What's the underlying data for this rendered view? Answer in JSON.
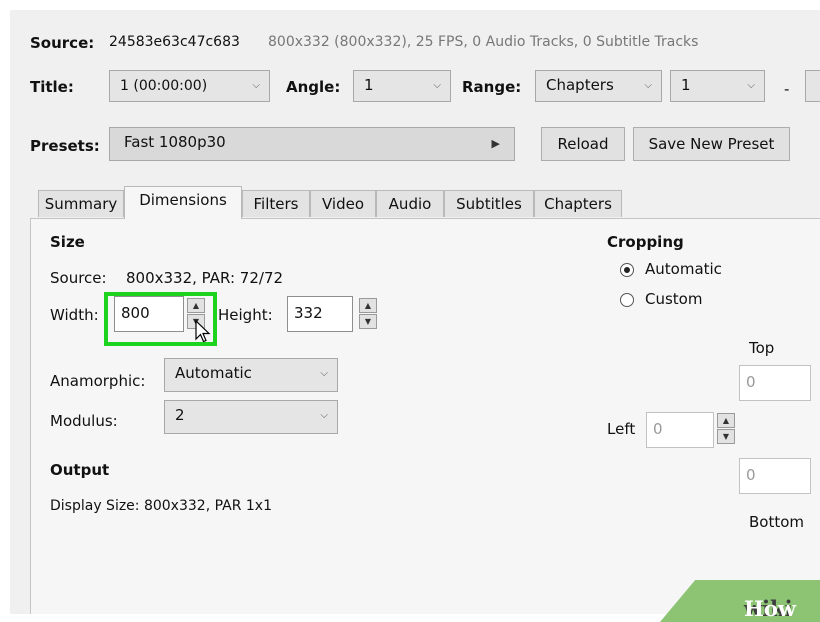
{
  "source": {
    "label": "Source:",
    "name": "24583e63c47c683",
    "info": "800x332 (800x332), 25 FPS, 0 Audio Tracks, 0 Subtitle Tracks"
  },
  "title_row": {
    "title_label": "Title:",
    "title_value": "1 (00:00:00)",
    "angle_label": "Angle:",
    "angle_value": "1",
    "range_label": "Range:",
    "range_value": "Chapters",
    "range_start": "1",
    "dash": "-"
  },
  "presets": {
    "label": "Presets:",
    "value": "Fast 1080p30",
    "reload_label": "Reload",
    "save_label": "Save New Preset"
  },
  "tabs": [
    {
      "label": "Summary"
    },
    {
      "label": "Dimensions"
    },
    {
      "label": "Filters"
    },
    {
      "label": "Video"
    },
    {
      "label": "Audio"
    },
    {
      "label": "Subtitles"
    },
    {
      "label": "Chapters"
    }
  ],
  "dimensions": {
    "size_heading": "Size",
    "source_label": "Source:",
    "source_value": "800x332, PAR: 72/72",
    "width_label": "Width:",
    "width_value": "800",
    "height_label": "Height:",
    "height_value": "332",
    "anamorphic_label": "Anamorphic:",
    "anamorphic_value": "Automatic",
    "modulus_label": "Modulus:",
    "modulus_value": "2",
    "output_heading": "Output",
    "display_size": "Display Size: 800x332,  PAR 1x1"
  },
  "cropping": {
    "heading": "Cropping",
    "automatic_label": "Automatic",
    "custom_label": "Custom",
    "selected": "Automatic",
    "top_label": "Top",
    "top_value": "0",
    "left_label": "Left",
    "left_value": "0",
    "bottom_label": "Bottom",
    "bottom_value": "0"
  },
  "watermark": {
    "part1": "wiki",
    "part2": "How"
  },
  "colors": {
    "highlight": "#1ed31e",
    "watermark_bg": "#8cc474"
  }
}
